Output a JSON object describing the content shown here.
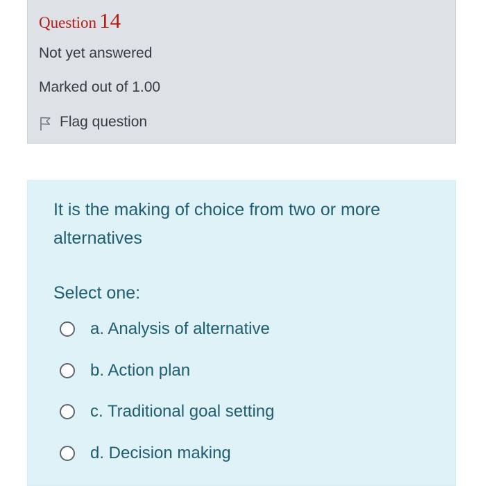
{
  "info": {
    "question_word": "Question",
    "question_number": "14",
    "state": "Not yet answered",
    "grade": "Marked out of 1.00",
    "flag_label": "Flag question"
  },
  "question": {
    "text": "It is the making of choice from two or more alternatives",
    "prompt": "Select one:",
    "options": [
      {
        "label": "a. Analysis of alternative",
        "selected": false
      },
      {
        "label": "b. Action plan",
        "selected": false
      },
      {
        "label": "c. Traditional goal setting",
        "selected": false
      },
      {
        "label": "d. Decision making",
        "selected": false
      }
    ]
  },
  "colors": {
    "question_number": "#b41c17",
    "info_background": "#dee2e6",
    "formulation_background": "#def2f8",
    "formulation_text": "#1f5e72"
  },
  "icons": {
    "flag": "flag-outline-icon",
    "radio": "radio-unchecked-icon"
  }
}
